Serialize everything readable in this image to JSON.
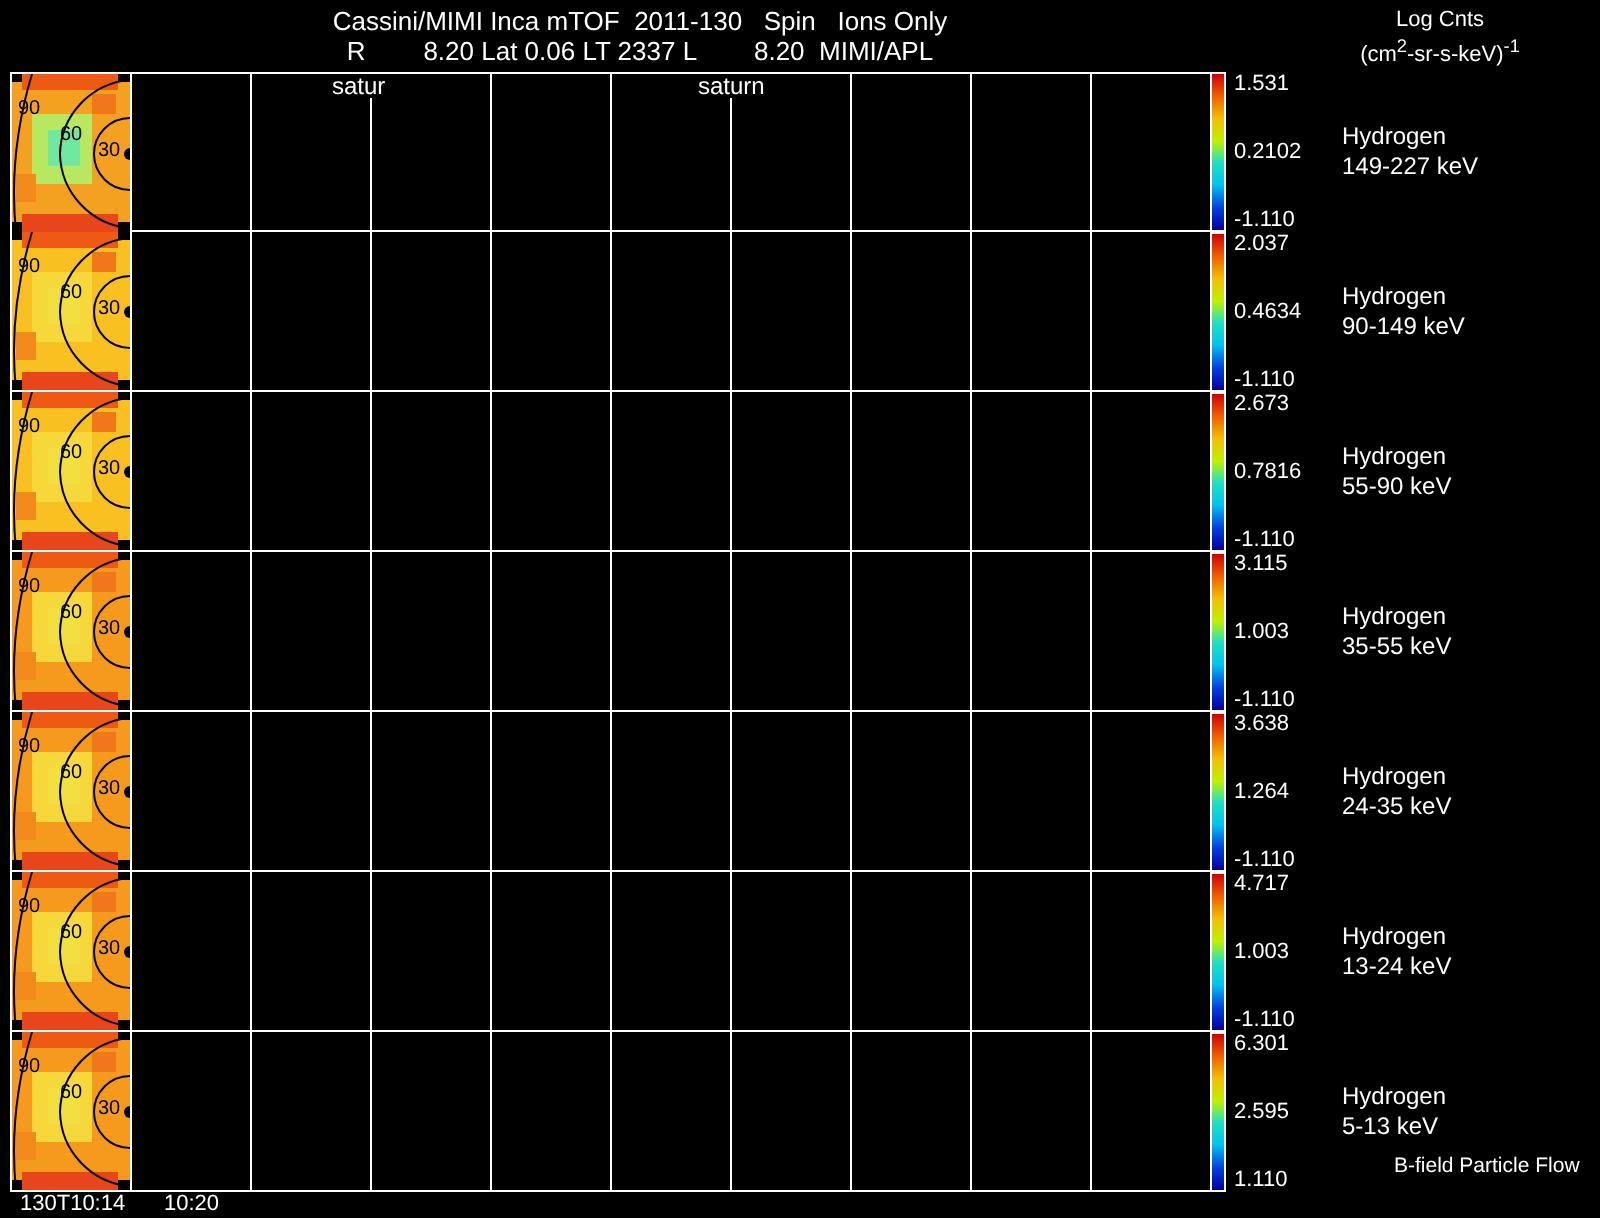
{
  "header": {
    "title": "Cassini/MIMI Inca mTOF  2011-130   Spin   Ions Only",
    "subtitle": "R        8.20 Lat 0.06 LT 2337 L        8.20  MIMI/APL",
    "overlays": [
      "satur",
      "saturn"
    ]
  },
  "units": {
    "label": "Log Cnts",
    "expression": "(cm$^{2}$-sr-s-keV)$^{-1}$"
  },
  "panels": [
    {
      "species": "Hydrogen",
      "energy": "149-227 keV",
      "max": "1.531",
      "mid": "0.2102",
      "min": "-1.110",
      "contours": [
        "90",
        "60",
        "30"
      ]
    },
    {
      "species": "Hydrogen",
      "energy": "90-149 keV",
      "max": "2.037",
      "mid": "0.4634",
      "min": "-1.110",
      "contours": [
        "90",
        "60",
        "30"
      ]
    },
    {
      "species": "Hydrogen",
      "energy": "55-90 keV",
      "max": "2.673",
      "mid": "0.7816",
      "min": "-1.110",
      "contours": [
        "90",
        "60",
        "30"
      ]
    },
    {
      "species": "Hydrogen",
      "energy": "35-55 keV",
      "max": "3.115",
      "mid": "1.003",
      "min": "-1.110",
      "contours": [
        "90",
        "60",
        "30"
      ]
    },
    {
      "species": "Hydrogen",
      "energy": "24-35 keV",
      "max": "3.638",
      "mid": "1.264",
      "min": "-1.110",
      "contours": [
        "90",
        "60",
        "30"
      ]
    },
    {
      "species": "Hydrogen",
      "energy": "13-24 keV",
      "max": "4.717",
      "mid": "1.003",
      "min": "-1.110",
      "contours": [
        "90",
        "60",
        "30"
      ]
    },
    {
      "species": "Hydrogen",
      "energy": "5-13 keV",
      "max": "6.301",
      "mid": "2.595",
      "min": "1.110",
      "contours": [
        "90",
        "60",
        "30"
      ]
    }
  ],
  "note": "B-field Particle Flow",
  "time_labels": [
    "130T10:14",
    "10:20"
  ]
}
